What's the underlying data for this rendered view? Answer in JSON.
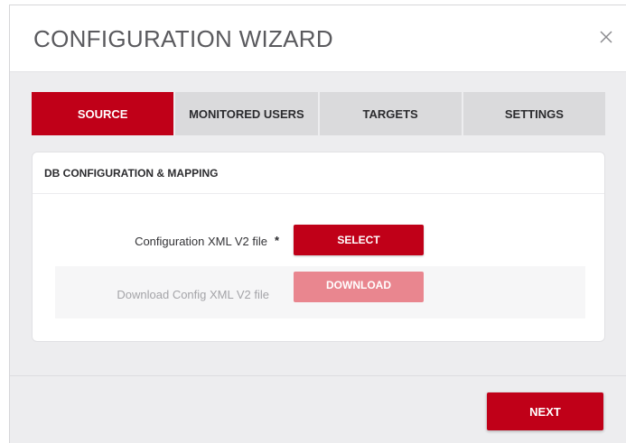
{
  "dialog": {
    "title": "CONFIGURATION WIZARD",
    "close_icon": "close-icon"
  },
  "tabs": [
    {
      "label": "SOURCE",
      "active": true
    },
    {
      "label": "MONITORED USERS",
      "active": false
    },
    {
      "label": "TARGETS",
      "active": false
    },
    {
      "label": "SETTINGS",
      "active": false
    }
  ],
  "panel": {
    "title": "DB CONFIGURATION & MAPPING",
    "rows": [
      {
        "label": "Configuration XML V2 file",
        "required_marker": "*",
        "button_label": "SELECT",
        "enabled": true
      },
      {
        "label": "Download Config XML V2 file",
        "button_label": "DOWNLOAD",
        "enabled": false
      }
    ]
  },
  "footer": {
    "next_label": "NEXT"
  },
  "colors": {
    "accent": "#c00018",
    "accent_disabled": "#e9868f",
    "tab_inactive": "#dadadc",
    "dialog_bg": "#ededef"
  }
}
